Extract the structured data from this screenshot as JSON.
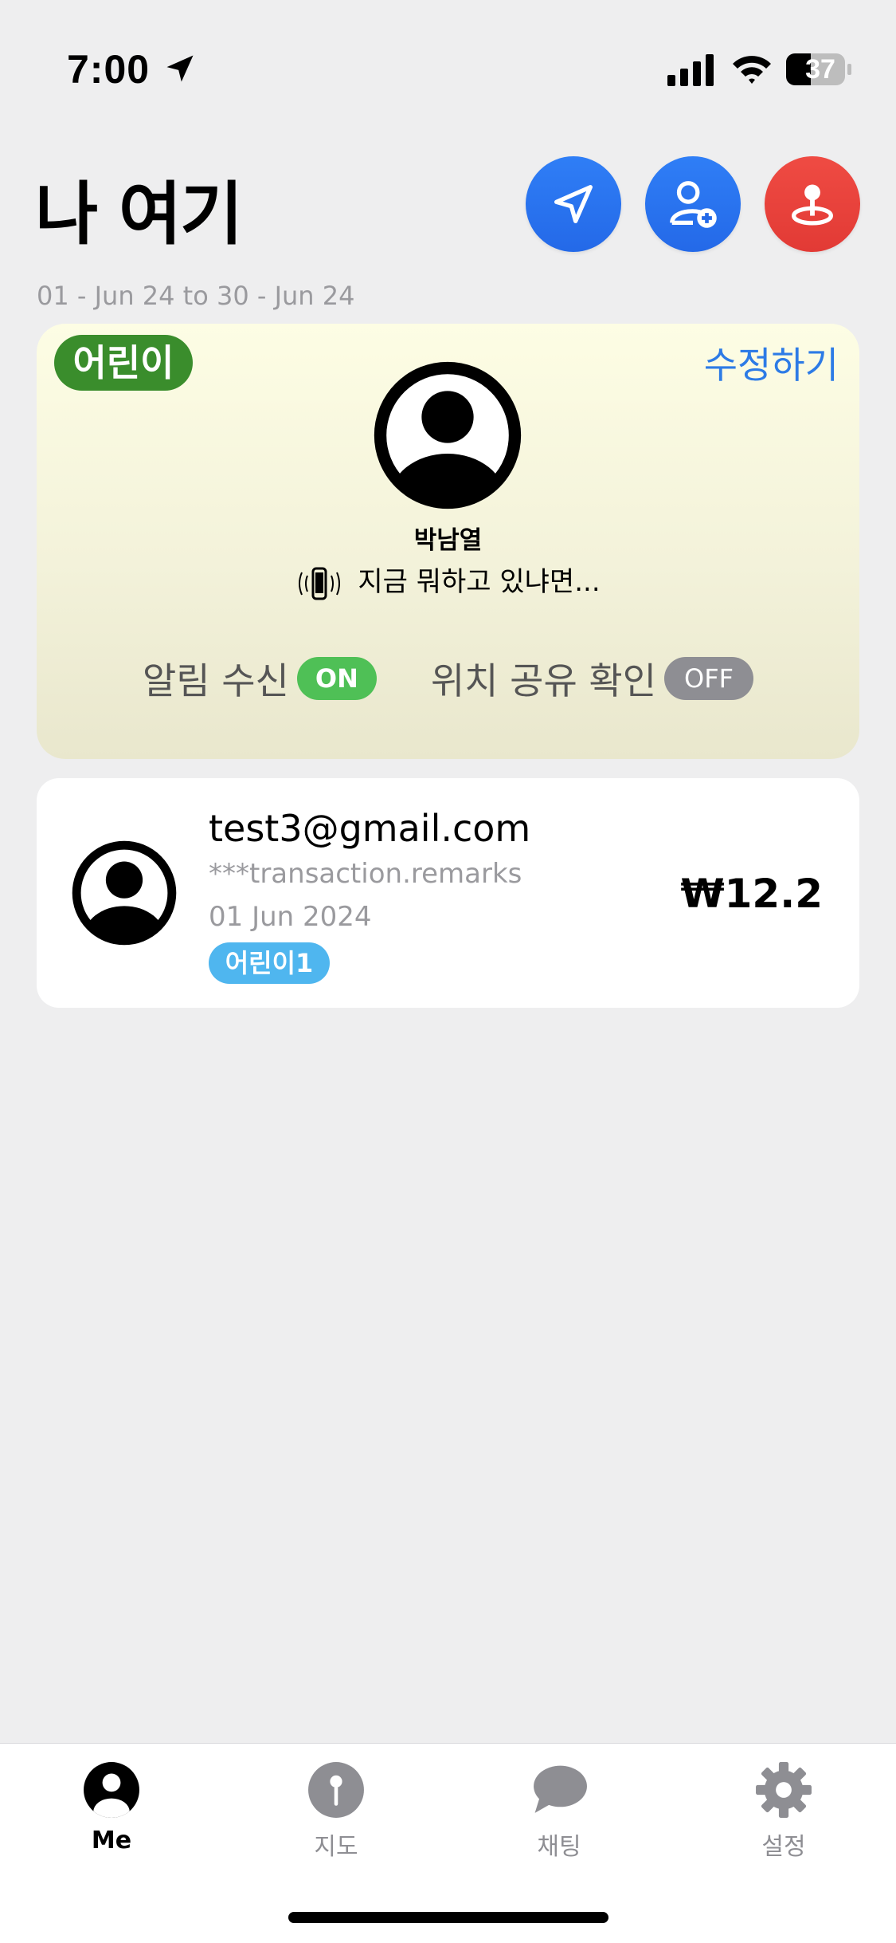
{
  "status_bar": {
    "time": "7:00",
    "battery": "37"
  },
  "header": {
    "title": "나 여기",
    "date_range": "01 - Jun 24 to 30 - Jun 24"
  },
  "profile": {
    "role_badge": "어린이",
    "edit_label": "수정하기",
    "name": "박남열",
    "status_text": "지금 뭐하고 있냐면...",
    "notification_label": "알림 수신",
    "notification_state": "ON",
    "location_share_label": "위치 공유 확인",
    "location_share_state": "OFF"
  },
  "transactions": [
    {
      "email": "test3@gmail.com",
      "remarks": "***transaction.remarks",
      "date": "01 Jun 2024",
      "tag": "어린이1",
      "amount": "₩12.2"
    }
  ],
  "tab_bar": {
    "tabs": [
      {
        "label": "Me",
        "icon": "person-circle-icon",
        "active": true
      },
      {
        "label": "지도",
        "icon": "map-pin-icon",
        "active": false
      },
      {
        "label": "채팅",
        "icon": "chat-bubble-icon",
        "active": false
      },
      {
        "label": "설정",
        "icon": "gear-icon",
        "active": false
      }
    ]
  },
  "colors": {
    "accent_blue": "#2f7ef6",
    "accent_red": "#ef4b43",
    "badge_green": "#3a8d2c",
    "toggle_on": "#4fc056",
    "toggle_off": "#8e8e93",
    "tag_blue": "#4fb6ef"
  }
}
